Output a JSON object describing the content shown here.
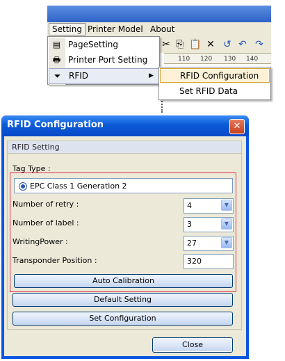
{
  "menubar": {
    "items": [
      {
        "label": "Setting",
        "active": true
      },
      {
        "label": "Printer Model"
      },
      {
        "label": "About"
      }
    ]
  },
  "setting_menu": {
    "items": [
      {
        "label": "PageSetting",
        "icon": "page-setting-icon"
      },
      {
        "label": "Printer Port Setting",
        "icon": "printer-icon"
      },
      {
        "label": "RFID",
        "icon": "rfid-filter-icon",
        "has_submenu": true
      }
    ]
  },
  "rfid_submenu": {
    "items": [
      {
        "label": "RFID Configuration",
        "highlighted": true
      },
      {
        "label": "Set RFID Data"
      }
    ]
  },
  "ruler": {
    "ticks": [
      "110",
      "120",
      "130",
      "140"
    ]
  },
  "dialog": {
    "title": "RFID Configuration",
    "close_glyph": "✕",
    "group_title": "RFID Setting",
    "tag_type": {
      "label": "Tag Type :",
      "value": "EPC Class 1 Generation 2"
    },
    "retry": {
      "label": "Number of retry :",
      "value": "4"
    },
    "label_count": {
      "label": "Number of label :",
      "value": "3"
    },
    "writing_power": {
      "label": "WritingPower :",
      "value": "27"
    },
    "transponder_position": {
      "label": "Transponder Position :",
      "value": "320"
    },
    "buttons": {
      "auto_calibration": "Auto Calibration",
      "default_setting": "Default Setting",
      "set_configuration": "Set Configuration",
      "close": "Close"
    }
  },
  "colors": {
    "title_blue": "#0a5ad8",
    "highlight_border": "#d9304e",
    "dialog_bg": "#ece9d8"
  }
}
